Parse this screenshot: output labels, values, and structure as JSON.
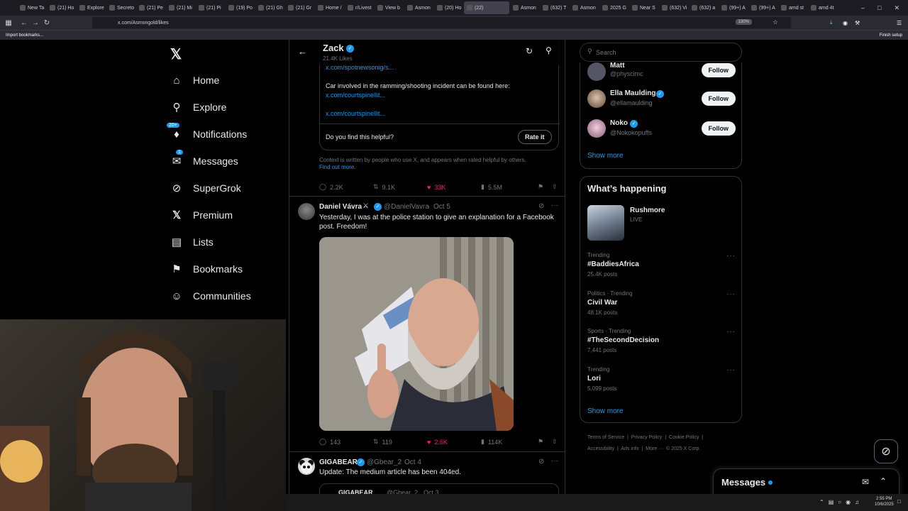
{
  "browser": {
    "tabs": [
      "New Ta",
      "(21) Ho",
      "Explore",
      "Secreto",
      "(21) Pe",
      "(21) Mi",
      "(21) Pi",
      "(19) Po",
      "(21) Gh",
      "(21) Gr",
      "Home /",
      "r/Livest",
      "View b",
      "Asmon",
      "(20) Ho",
      "(22)",
      "Asmon",
      "(632) T",
      "Asmon",
      "2025 G",
      "Near S",
      "(632) Vi",
      "(632) a",
      "(99+) A",
      "(99+) A",
      "amd st",
      "amd 4t"
    ],
    "url": "x.com/Asmongold/likes",
    "zoom": "130%",
    "bookmark_import": "Import bookmarks...",
    "finish_setup": "Finish setup"
  },
  "sidebar": {
    "items": [
      {
        "label": "Home",
        "icon": "home-icon"
      },
      {
        "label": "Explore",
        "icon": "search-icon"
      },
      {
        "label": "Notifications",
        "icon": "bell-icon",
        "badge": "20+"
      },
      {
        "label": "Messages",
        "icon": "mail-icon",
        "badge": "1"
      },
      {
        "label": "SuperGrok",
        "icon": "grok-icon"
      },
      {
        "label": "Premium",
        "icon": "x-logo-icon"
      },
      {
        "label": "Lists",
        "icon": "list-icon"
      },
      {
        "label": "Bookmarks",
        "icon": "bookmark-icon"
      },
      {
        "label": "Communities",
        "icon": "people-icon"
      }
    ]
  },
  "header": {
    "name": "Zack",
    "likes": "21.4K Likes"
  },
  "note": {
    "link1": "x.com/spotnewsonig/s...",
    "text": "Car involved in the ramming/shooting incident can be found here:",
    "link2": "x.com/courtspinellit...",
    "link3": "x.com/courtspinellit...",
    "helpful_q": "Do you find this helpful?",
    "rate_btn": "Rate it",
    "context": "Context is written by people who use X, and appears when rated helpful by others.",
    "find_out": "Find out more."
  },
  "tweet1_stats": {
    "replies": "2.2K",
    "reposts": "9.1K",
    "likes": "33K",
    "views": "5.5M"
  },
  "tweet2": {
    "name": "Daniel Vávra",
    "handle": "@DanielVavra",
    "date": "Oct 5",
    "text": "Yesterday, I was at the police station to give an explanation for a Facebook post. Freedom!",
    "replies": "143",
    "reposts": "119",
    "likes": "2.6K",
    "views": "114K"
  },
  "tweet3": {
    "name": "GIGABEAR",
    "handle": "@Gbear_2",
    "date": "Oct 4",
    "text": "Update: The medium article has been 404ed.",
    "quote_name": "GIGABEAR",
    "quote_handle": "@Gbear_2",
    "quote_date": "Oct 3"
  },
  "right": {
    "search_placeholder": "Search",
    "follow_suggestions": [
      {
        "name": "Matt",
        "handle": "@physcimc",
        "button": "Follow"
      },
      {
        "name": "Ella Maulding",
        "handle": "@ellamaulding",
        "button": "Follow"
      },
      {
        "name": "Noko",
        "handle": "@Nokokopuffs",
        "button": "Follow"
      }
    ],
    "show_more": "Show more",
    "happening_title": "What’s happening",
    "live": {
      "title": "Rushmore",
      "status": "LIVE"
    },
    "trends": [
      {
        "context": "Trending",
        "name": "#BaddiesAfrica",
        "posts": "25.4K posts"
      },
      {
        "context": "Politics · Trending",
        "name": "Civil War",
        "posts": "48.1K posts"
      },
      {
        "context": "Sports · Trending",
        "name": "#TheSecondDecision",
        "posts": "7,441 posts"
      },
      {
        "context": "Trending",
        "name": "Lori",
        "posts": "5,099 posts"
      }
    ],
    "show_more2": "Show more",
    "footer": [
      "Terms of Service",
      "Privacy Policy",
      "Cookie Policy",
      "Accessibility",
      "Ads info",
      "More ···",
      "© 2025 X Corp."
    ],
    "messages": "Messages"
  },
  "taskbar": {
    "time": "2:55 PM",
    "date": "10/6/2025"
  },
  "colors": {
    "accent": "#1d9bf0",
    "like": "#f91880",
    "bg": "#000000"
  }
}
